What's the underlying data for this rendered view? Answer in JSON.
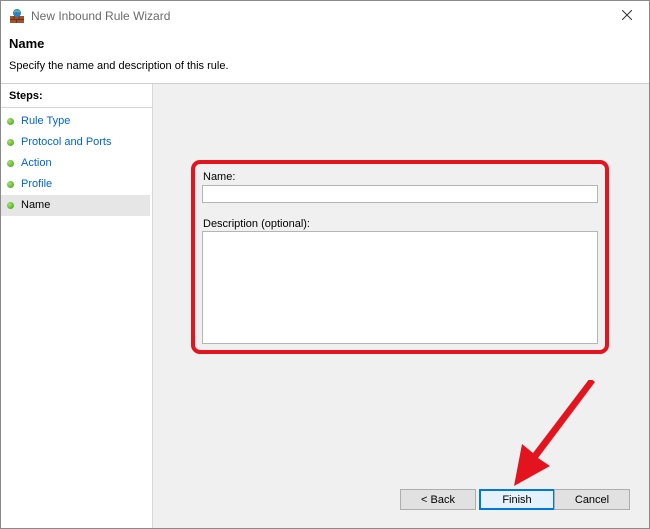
{
  "window": {
    "title": "New Inbound Rule Wizard"
  },
  "header": {
    "title": "Name",
    "description": "Specify the name and description of this rule."
  },
  "steps": {
    "heading": "Steps:",
    "items": [
      {
        "label": "Rule Type"
      },
      {
        "label": "Protocol and Ports"
      },
      {
        "label": "Action"
      },
      {
        "label": "Profile"
      },
      {
        "label": "Name",
        "current": true
      }
    ]
  },
  "form": {
    "name_label": "Name:",
    "name_value": "",
    "description_label": "Description (optional):",
    "description_value": ""
  },
  "buttons": {
    "back": "< Back",
    "finish": "Finish",
    "cancel": "Cancel"
  },
  "colors": {
    "highlight": "#e3141e",
    "step_link": "#0066cc",
    "step_dot": "#3c9a1a"
  },
  "icons": {
    "app": "firewall-icon",
    "close": "close-icon",
    "step": "green-dot-icon",
    "annotation": "red-arrow-icon"
  }
}
